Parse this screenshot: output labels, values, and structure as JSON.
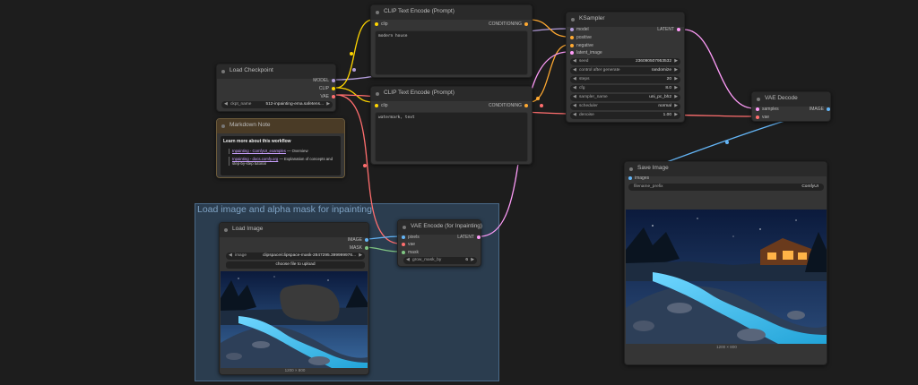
{
  "colors": {
    "canvas_bg": "#1d1d1d",
    "node_bg": "#353535",
    "group_bg": "#2b3d4f",
    "model_wire": "#b39ddb",
    "clip_wire": "#ffd500",
    "vae_wire": "#ff6e6e",
    "conditioning_wire": "#ffa931",
    "latent_wire": "#ff9cf9",
    "image_wire": "#64b5f6",
    "mask_wire": "#81c784"
  },
  "group": {
    "title": "Load image and alpha mask for inpainting"
  },
  "clip_pos": {
    "title": "CLIP Text Encode (Prompt)",
    "input": "clip",
    "output": "CONDITIONING",
    "text": "modern house"
  },
  "clip_neg": {
    "title": "CLIP Text Encode (Prompt)",
    "input": "clip",
    "output": "CONDITIONING",
    "text": "watermark, text"
  },
  "ksampler": {
    "title": "KSampler",
    "inputs": [
      "model",
      "positive",
      "negative",
      "latent_image"
    ],
    "output": "LATENT",
    "widgets": [
      {
        "label": "seed",
        "value": "236090507953532"
      },
      {
        "label": "control after generate",
        "value": "randomize"
      },
      {
        "label": "steps",
        "value": "20"
      },
      {
        "label": "cfg",
        "value": "8.0"
      },
      {
        "label": "sampler_name",
        "value": "uni_pc_bh2"
      },
      {
        "label": "scheduler",
        "value": "normal"
      },
      {
        "label": "denoise",
        "value": "1.00"
      }
    ]
  },
  "load_checkpoint": {
    "title": "Load Checkpoint",
    "outputs": [
      "MODEL",
      "CLIP",
      "VAE"
    ],
    "widget_label": "ckpt_name",
    "widget_value": "512-inpainting-ema.safetens..."
  },
  "markdown_note": {
    "title": "Markdown Note",
    "heading": "Learn more about this workflow",
    "link1": "Inpainting - ComfyUI_examples",
    "link1_desc": "— Overview",
    "link2": "Inpainting - docs.comfy.org",
    "link2_desc": "— Explanation of concepts and step-by-step tutorial"
  },
  "vae_decode": {
    "title": "VAE Decode",
    "inputs": [
      "samples",
      "vae"
    ],
    "output": "IMAGE"
  },
  "save_image": {
    "title": "Save Image",
    "input": "images",
    "widget_label": "filename_prefix",
    "widget_value": "ComfyUI",
    "caption": "1200 × 800"
  },
  "load_image": {
    "title": "Load Image",
    "outputs": [
      "IMAGE",
      "MASK"
    ],
    "widget_label": "image",
    "widget_value": "clipspace/clipspace-mask-2847295.399999976...",
    "upload_label": "choose file to upload",
    "caption": "1200 × 800"
  },
  "vae_encode": {
    "title": "VAE Encode (for Inpainting)",
    "inputs": [
      "pixels",
      "vae",
      "mask"
    ],
    "output": "LATENT",
    "widget_label": "grow_mask_by",
    "widget_value": "6"
  }
}
